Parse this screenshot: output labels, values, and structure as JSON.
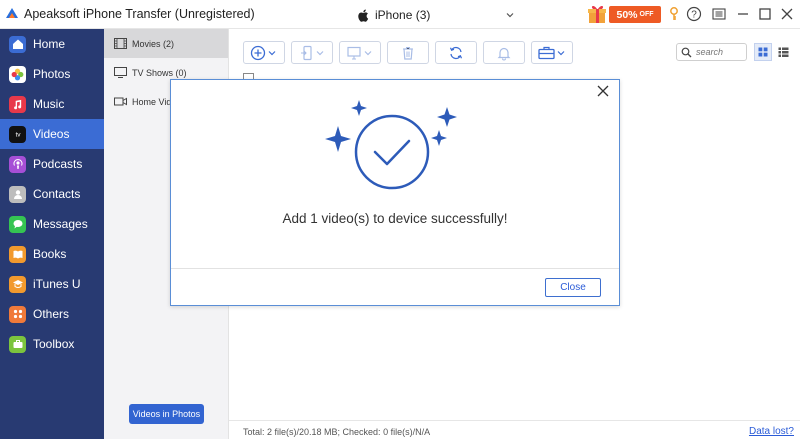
{
  "app": {
    "title": "Apeaksoft iPhone Transfer (Unregistered)"
  },
  "device": {
    "name": "iPhone (3)"
  },
  "promo": {
    "discount": "50%",
    "suffix": "OFF"
  },
  "sidebar": {
    "items": [
      {
        "label": "Home",
        "icon": "home-icon",
        "color": "#3b6cd4"
      },
      {
        "label": "Photos",
        "icon": "photos-icon",
        "color": "#ffffff"
      },
      {
        "label": "Music",
        "icon": "music-icon",
        "color": "#e8394a"
      },
      {
        "label": "Videos",
        "icon": "apple-tv-icon",
        "color": "#111111"
      },
      {
        "label": "Podcasts",
        "icon": "podcasts-icon",
        "color": "#a64fd6"
      },
      {
        "label": "Contacts",
        "icon": "contacts-icon",
        "color": "#bdbdbd"
      },
      {
        "label": "Messages",
        "icon": "messages-icon",
        "color": "#35c452"
      },
      {
        "label": "Books",
        "icon": "books-icon",
        "color": "#f29a2e"
      },
      {
        "label": "iTunes U",
        "icon": "itunes-u-icon",
        "color": "#f29a2e"
      },
      {
        "label": "Others",
        "icon": "others-icon",
        "color": "#f07a3a"
      },
      {
        "label": "Toolbox",
        "icon": "toolbox-icon",
        "color": "#7cc43e"
      }
    ],
    "active": "Videos"
  },
  "subpanel": {
    "items": [
      {
        "label": "Movies (2)",
        "icon": "film-icon"
      },
      {
        "label": "TV Shows (0)",
        "icon": "tv-icon"
      },
      {
        "label": "Home Video",
        "icon": "camera-icon"
      }
    ],
    "photos_button": "Videos in Photos"
  },
  "search": {
    "placeholder": "search"
  },
  "status": {
    "summary": "Total: 2 file(s)/20.18 MB; Checked: 0 file(s)/N/A",
    "data_lost": "Data lost?"
  },
  "modal": {
    "message": "Add 1 video(s) to device successfully!",
    "close_label": "Close",
    "accent": "#2d5bb9"
  }
}
